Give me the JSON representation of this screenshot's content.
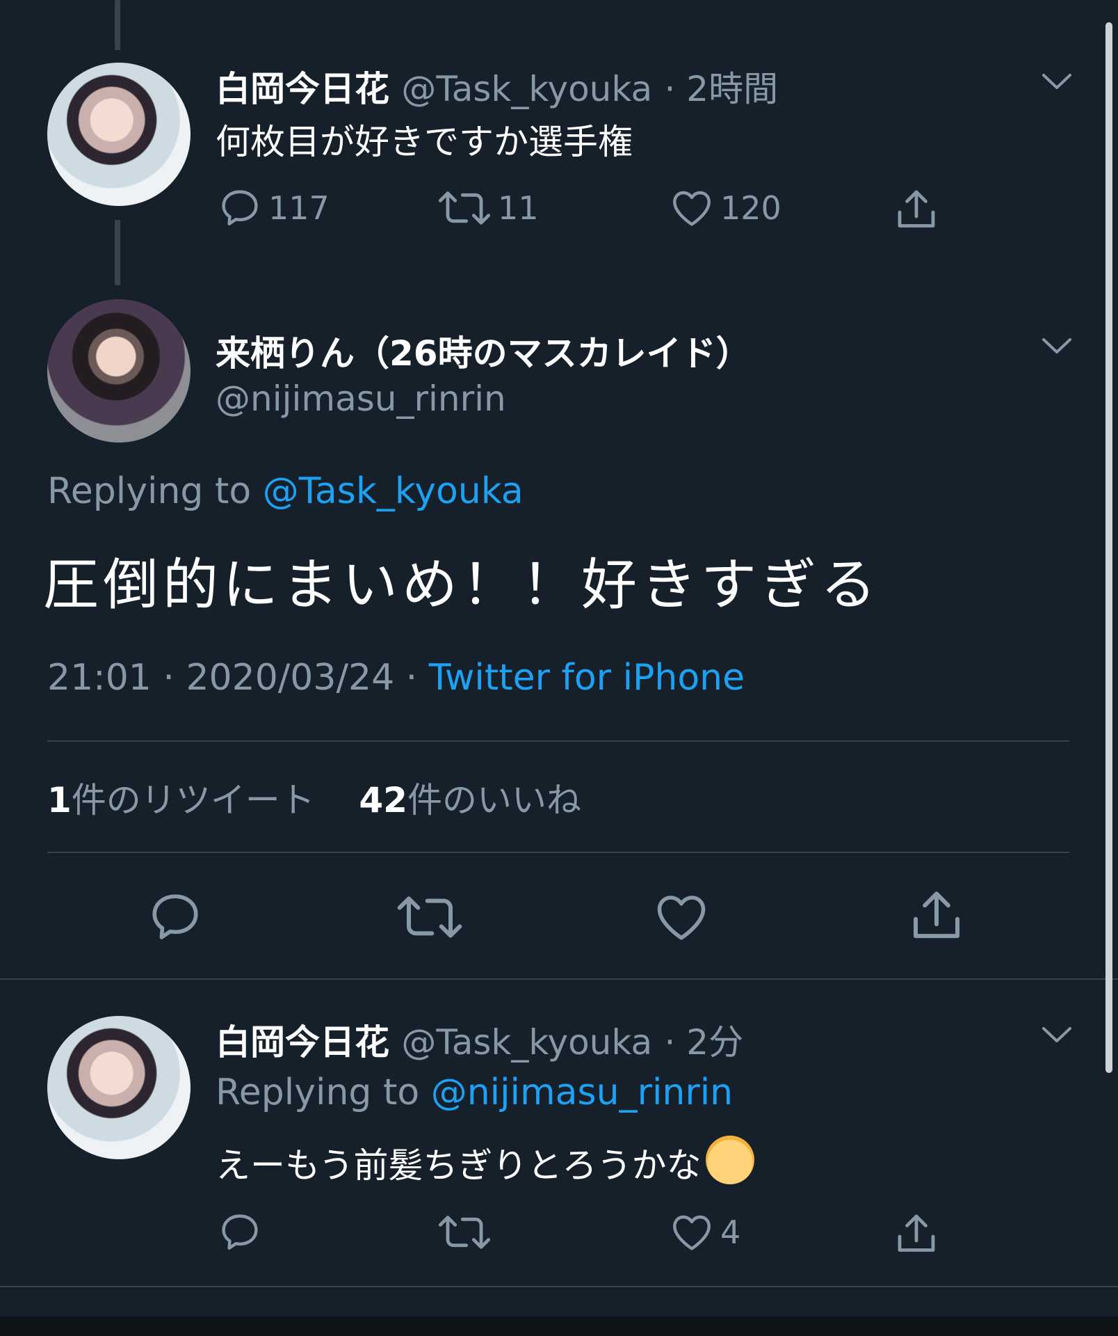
{
  "tweet1": {
    "display_name": "白岡今日花",
    "handle": "@Task_kyouka",
    "time": "· 2時間",
    "text": "何枚目が好きですか選手権",
    "reply_count": "117",
    "retweet_count": "11",
    "like_count": "120"
  },
  "main_tweet": {
    "display_name": "来栖りん（26時のマスカレイド）",
    "handle": "@nijimasu_rinrin",
    "replying_label": "Replying to",
    "replying_to": "@Task_kyouka",
    "text": "圧倒的にまいめ！！好きすぎる",
    "timestamp": "21:01 · 2020/03/24 ·",
    "source": "Twitter for iPhone",
    "retweets_num": "1",
    "retweets_label": "件のリツイート",
    "likes_num": "42",
    "likes_label": "件のいいね"
  },
  "reply_tweet": {
    "display_name": "白岡今日花",
    "handle": "@Task_kyouka",
    "time": "· 2分",
    "replying_label": "Replying to",
    "replying_to": "@nijimasu_rinrin",
    "text": "えーもう前髪ちぎりとろうかな",
    "like_count": "4"
  },
  "colors": {
    "background": "#15202b",
    "text_primary": "#ffffff",
    "text_secondary": "#8899a6",
    "link": "#1da1f2",
    "divider": "#38444d"
  },
  "icons": [
    "reply-icon",
    "retweet-icon",
    "like-icon",
    "share-icon",
    "chevron-down-icon",
    "baby-emoji"
  ]
}
